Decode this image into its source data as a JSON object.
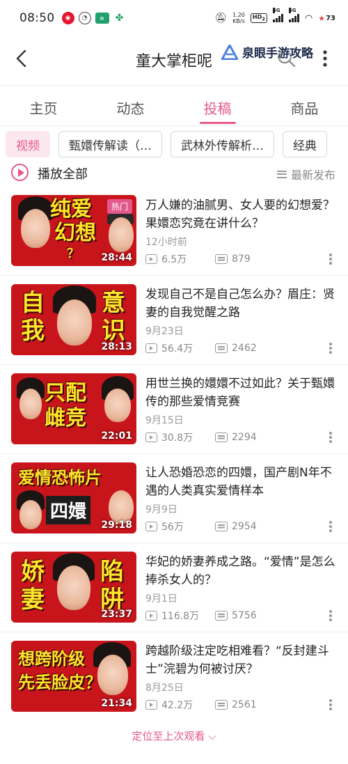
{
  "status_bar": {
    "time": "08:50",
    "net_speed_value": "1.20",
    "net_speed_unit": "KB/s",
    "hd_label": "HD",
    "hd_sub": "2",
    "sig1": "5G",
    "sig2": "5G",
    "battery": "73"
  },
  "header": {
    "title": "童大掌柜呢",
    "watermark": "泉眼手游攻略"
  },
  "tabs": [
    {
      "label": "主页"
    },
    {
      "label": "动态"
    },
    {
      "label": "投稿",
      "active": true
    },
    {
      "label": "商品"
    }
  ],
  "chips": [
    {
      "label": "视频",
      "active": true
    },
    {
      "label": "甄嬛传解读（…"
    },
    {
      "label": "武林外传解析…"
    },
    {
      "label": "经典"
    }
  ],
  "play_all_label": "播放全部",
  "sort_label": "最新发布",
  "videos": [
    {
      "title": "万人嫌的油腻男、女人要的幻想爱？果嬛恋究竟在讲什么？",
      "date": "12小时前",
      "views": "6.5万",
      "danmu": "879",
      "duration": "28:44",
      "badge": "热门",
      "thumb_text": [
        "纯爱",
        "幻想",
        "？"
      ]
    },
    {
      "title": "发现自己不是自己怎么办？眉庄：贤妻的自我觉醒之路",
      "date": "9月23日",
      "views": "56.4万",
      "danmu": "2462",
      "duration": "28:13",
      "thumb_text": [
        "自",
        "意",
        "我",
        "识"
      ]
    },
    {
      "title": "用世兰换的嬛嬛不过如此？关于甄嬛传的那些爱情竞赛",
      "date": "9月15日",
      "views": "30.8万",
      "danmu": "2294",
      "duration": "22:01",
      "thumb_text": [
        "只配",
        "雌竞"
      ]
    },
    {
      "title": "让人恐婚恐恋的四嬛，国产剧N年不遇的人类真实爱情样本",
      "date": "9月9日",
      "views": "56万",
      "danmu": "2954",
      "duration": "29:18",
      "thumb_text": [
        "爱情恐怖片",
        "四嬛"
      ]
    },
    {
      "title": "华妃的娇妻养成之路。“爱情”是怎么捧杀女人的？",
      "date": "9月1日",
      "views": "116.8万",
      "danmu": "5756",
      "duration": "23:37",
      "thumb_text": [
        "娇",
        "陷",
        "妻",
        "阱"
      ]
    },
    {
      "title": "跨越阶级注定吃相难看？“反封建斗士”浣碧为何被讨厌？",
      "date": "8月25日",
      "views": "42.2万",
      "danmu": "2561",
      "duration": "21:34",
      "thumb_text": [
        "想跨阶级",
        "先丢脸皮？"
      ]
    }
  ],
  "locate_label": "定位至上次观看",
  "colors": {
    "accent": "#e4598b",
    "chip_active_bg": "#fde7ef",
    "thumb_red": "#c8141b",
    "thumb_text": "#ffe52b"
  }
}
